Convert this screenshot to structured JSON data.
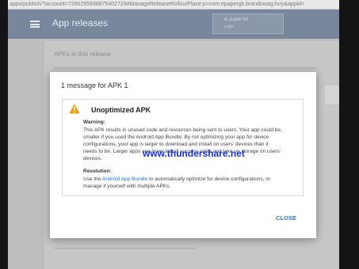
{
  "browser": {
    "url": "apps/publish/?account=7266295938875402729#ManageReleaseRolloutPlace:p=com.epapergk.brandowag.fury&appid="
  },
  "header": {
    "title": "App releases",
    "app_chip": {
      "line1": "e- paper kit",
      "line2": "v.apk"
    }
  },
  "page": {
    "section_title": "APKs in this release"
  },
  "dialog": {
    "title": "1 message for APK 1",
    "card_title": "Unoptimized APK",
    "warning_label": "Warning:",
    "warning_lines": [
      "This APK results in unused code and resources being sent to users. Your app could be",
      "smaller if you used the Android App Bundle. By not optimizing your app for device",
      "configurations, your app is larger to download and install on users' devices than it",
      "needs to be. Larger apps see lower install success rates and take up storage on users'",
      "devices."
    ],
    "resolution_label": "Resolution:",
    "resolution_pre": "Use the ",
    "resolution_link": "Android App Bundle",
    "resolution_post": " to automatically optimize for device configurations, or",
    "resolution_line2": "manage it yourself with multiple APKs.",
    "close_label": "CLOSE"
  },
  "watermark": "www.thundershare.net"
}
